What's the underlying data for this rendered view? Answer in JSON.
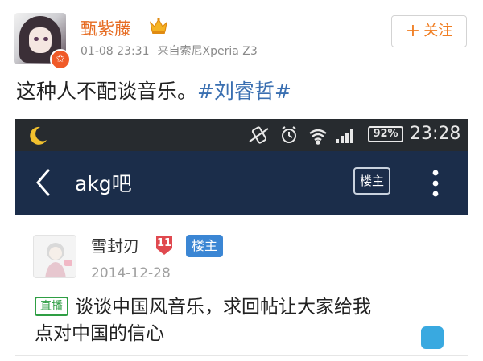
{
  "weibo": {
    "author": "甄紫藤",
    "time": "01-08 23:31",
    "source": "来自索尼Xperia Z3",
    "follow_label": "关注",
    "post_text": "这种人不配谈音乐。",
    "hashtag": "#刘睿哲#"
  },
  "phone": {
    "status": {
      "battery": "92%",
      "time": "23:28"
    },
    "appbar": {
      "title": "akg吧",
      "op_label": "楼主"
    },
    "post": {
      "username": "雪封刃",
      "level": "11",
      "op_badge": "楼主",
      "date": "2014-12-28",
      "tag": "直播",
      "title_line1": "谈谈中国风音乐，求回帖让大家给我",
      "title_line2": "点对中国的信心"
    }
  },
  "colors": {
    "author": "#e66b21",
    "hashtag": "#3a6fb1",
    "follow": "#f07d21",
    "statusbar": "#272b2f",
    "appbar": "#1b2d4a",
    "op_badge": "#3b86d4",
    "level_badge": "#e0494f",
    "live_tag": "#2f9e44"
  },
  "icons": [
    "crown-icon",
    "v-badge-icon",
    "moon-icon",
    "vibrate-icon",
    "alarm-icon",
    "wifi-icon",
    "signal-icon",
    "battery-icon",
    "back-icon",
    "more-icon"
  ]
}
